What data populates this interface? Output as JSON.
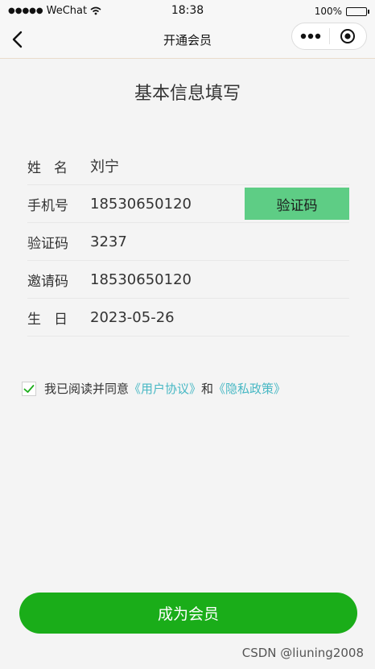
{
  "status_bar": {
    "signal_icon": "signal-dots-icon",
    "carrier": "WeChat",
    "time": "18:38",
    "battery": "100%"
  },
  "nav": {
    "title": "开通会员",
    "back_icon": "chevron-left-icon",
    "more_icon": "more-dots-icon",
    "close_icon": "target-circle-icon"
  },
  "page": {
    "heading": "基本信息填写"
  },
  "form": {
    "name_label": "姓名",
    "name_value": "刘宁",
    "phone_label": "手机号",
    "phone_value": "18530650120",
    "verify_button": "验证码",
    "code_label": "验证码",
    "code_value": "3237",
    "invite_label": "邀请码",
    "invite_value": "18530650120",
    "birthday_label": "生日",
    "birthday_value": "2023-05-26"
  },
  "agreement": {
    "checked": true,
    "prefix": "我已阅读并同意",
    "user_agreement": "《用户协议》",
    "and": "和",
    "privacy_policy": "《隐私政策》"
  },
  "submit_button": "成为会员",
  "watermark": "CSDN @liuning2008",
  "colors": {
    "primary_green": "#1aad19",
    "verify_green": "#5ecd85",
    "link_teal": "#48b8c4",
    "background": "#f4f4f4"
  }
}
